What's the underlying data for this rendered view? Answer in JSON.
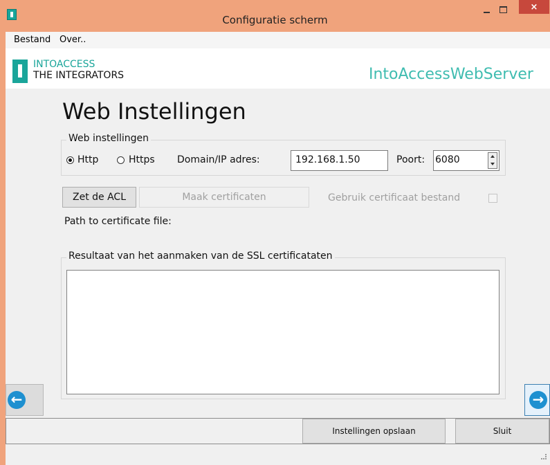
{
  "window": {
    "title": "Configuratie scherm",
    "close_glyph": "×"
  },
  "menu": {
    "items": [
      "Bestand",
      "Over.."
    ]
  },
  "header": {
    "logo_line1": "INTOACCESS",
    "logo_line2": "THE INTEGRATORS",
    "server_title": "IntoAccessWebServer"
  },
  "page": {
    "heading": "Web Instellingen"
  },
  "web_settings": {
    "legend": "Web instellingen",
    "radio_http": "Http",
    "radio_https": "Https",
    "selected_protocol": "Http",
    "domain_label": "Domain/IP adres:",
    "domain_value": "192.168.1.50",
    "port_label": "Poort:",
    "port_value": "6080"
  },
  "actions": {
    "acl_button": "Zet de ACL",
    "cert_button": "Maak certificaten",
    "use_cert_file_label": "Gebruik certificaat bestand",
    "use_cert_file_checked": false,
    "path_label": "Path to certificate file:"
  },
  "result": {
    "legend": "Resultaat van het aanmaken van de SSL certificataten",
    "text": ""
  },
  "nav": {
    "prev_glyph": "←",
    "next_glyph": "→"
  },
  "footer": {
    "save_button": "Instellingen opslaan",
    "close_button": "Sluit"
  },
  "colors": {
    "titlebar": "#f0a37c",
    "close_button": "#c7483c",
    "brand_teal": "#1aa59a",
    "arrow_blue": "#1e90d0"
  },
  "icons": {
    "app": "app-icon",
    "prev": "arrow-left-icon",
    "next": "arrow-right-icon",
    "spinner": "spinner-icon"
  }
}
